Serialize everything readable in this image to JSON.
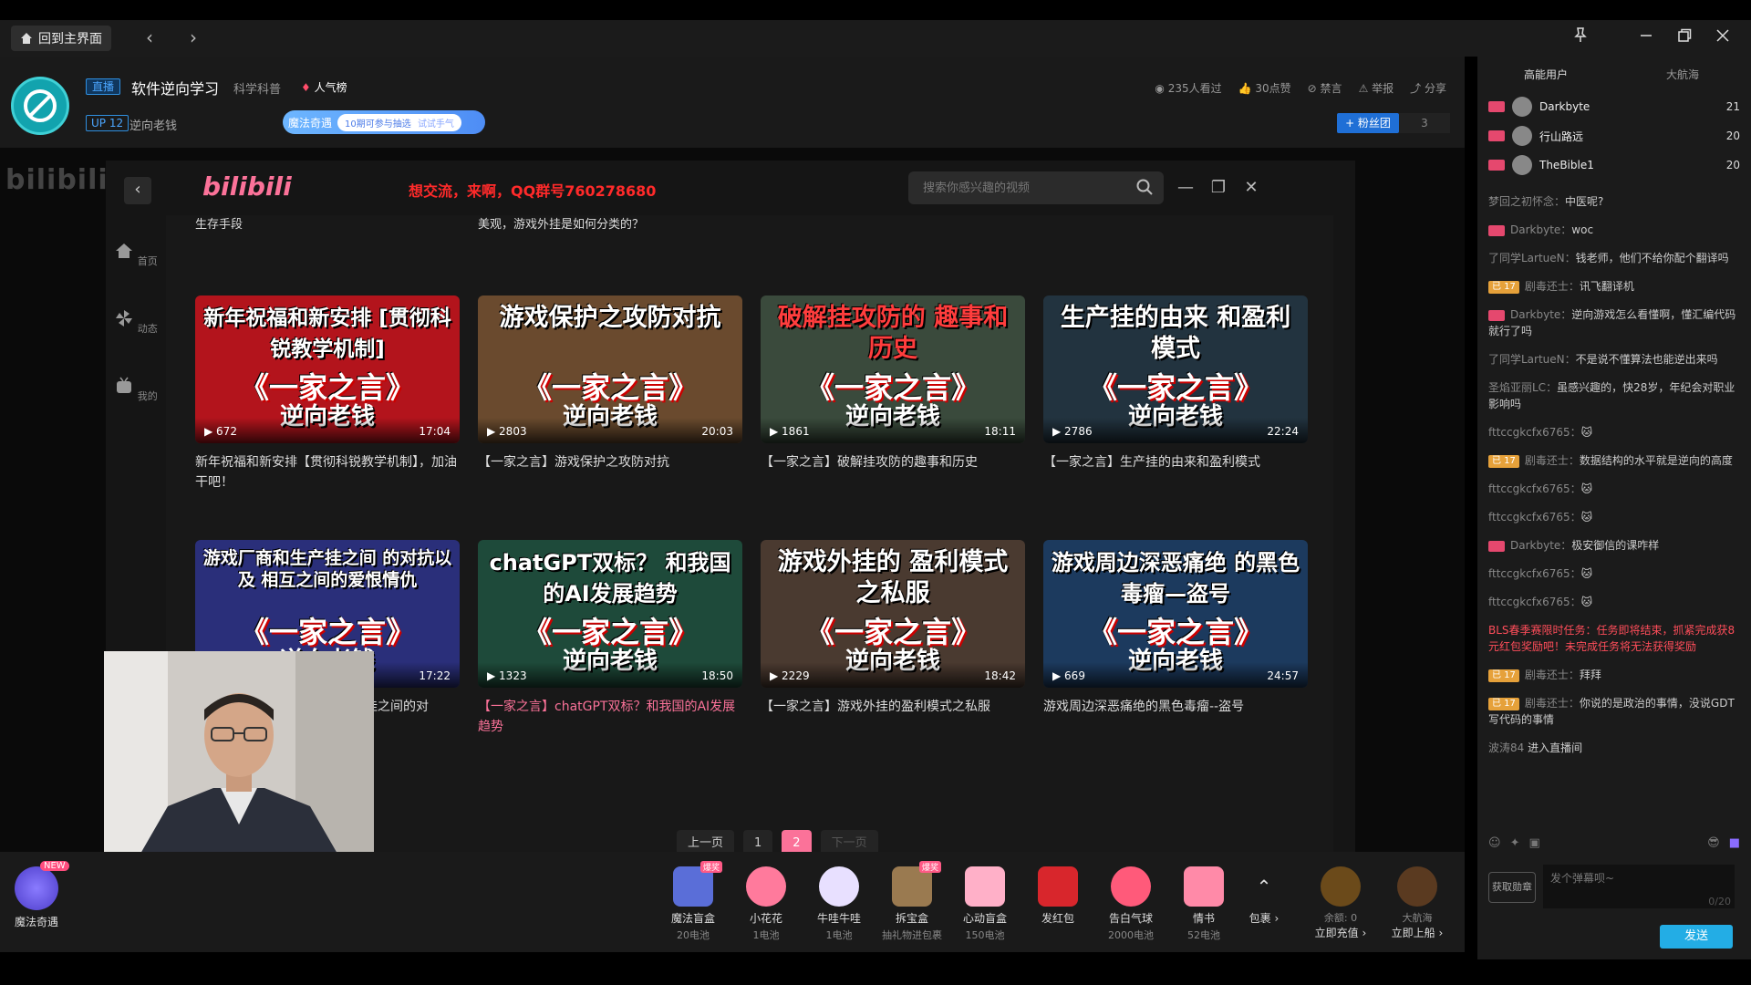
{
  "topbar": {
    "home_label": "回到主界面",
    "back": "‹",
    "forward": "›"
  },
  "header": {
    "live_tag": "直播",
    "title": "软件逆向学习",
    "category": "科学科普",
    "hot_rank": "人气榜",
    "up_level": "UP 12",
    "up_name": "逆向老钱",
    "magic_label": "魔法奇遇",
    "magic_promo": "10期可参与抽选",
    "magic_try": "试试手气",
    "stats": [
      "235人看过",
      "30点赞",
      "禁言",
      "举报",
      "分享"
    ],
    "fans_label": "+ 粉丝团",
    "fans_count": "3"
  },
  "browser": {
    "watermark": "bilibili直播",
    "logo": "bilibili",
    "notice": "想交流，来啊，QQ群号760278680",
    "search_placeholder": "搜索你感兴趣的视频",
    "side": [
      {
        "label": "首页"
      },
      {
        "label": "动态"
      },
      {
        "label": "我的"
      }
    ],
    "top_row": [
      "生存手段",
      "美观，游戏外挂是如何分类的？",
      "",
      ""
    ],
    "cards": [
      {
        "t1": "新年祝福和新安排 [贯彻科锐教学机制]",
        "t2": "《一家之言》",
        "t3": "逆向老钱",
        "plays": "672",
        "duration": "17:04",
        "title": "新年祝福和新安排【贯彻科锐教学机制】，加油干吧！",
        "bg": "#b3141c"
      },
      {
        "t1": "游戏保护之攻防对抗",
        "t2": "《一家之言》",
        "t3": "逆向老钱",
        "plays": "2803",
        "duration": "20:03",
        "title": "【一家之言】游戏保护之攻防对抗",
        "bg": "#6a4a2e"
      },
      {
        "t1": "破解挂攻防的 趣事和历史",
        "t2": "《一家之言》",
        "t3": "逆向老钱",
        "plays": "1861",
        "duration": "18:11",
        "title": "【一家之言】破解挂攻防的趣事和历史",
        "bg": "#3a4a3c"
      },
      {
        "t1": "生产挂的由来 和盈利模式",
        "t2": "《一家之言》",
        "t3": "逆向老钱",
        "plays": "2786",
        "duration": "22:24",
        "title": "【一家之言】生产挂的由来和盈利模式",
        "bg": "#22333f"
      },
      {
        "t1": "游戏厂商和生产挂之间 的对抗以及 相互之间的爱恨情仇",
        "t2": "《一家之言》",
        "t3": "逆向老钱",
        "plays": "",
        "duration": "17:22",
        "title": "挂之间的对",
        "bg": "#2a2f7a"
      },
      {
        "t1": "chatGPT双标？ 和我国的AI发展趋势",
        "t2": "《一家之言》",
        "t3": "逆向老钱",
        "plays": "1323",
        "duration": "18:50",
        "title": "【一家之言】chatGPT双标？和我国的AI发展趋势",
        "bg": "#1e4a3a"
      },
      {
        "t1": "游戏外挂的 盈利模式之私服",
        "t2": "《一家之言》",
        "t3": "逆向老钱",
        "plays": "2229",
        "duration": "18:42",
        "title": "【一家之言】游戏外挂的盈利模式之私服",
        "bg": "#4a3a30"
      },
      {
        "t1": "游戏周边深恶痛绝 的黑色毒瘤—盗号",
        "t2": "《一家之言》",
        "t3": "逆向老钱",
        "plays": "669",
        "duration": "24:57",
        "title": "游戏周边深恶痛绝的黑色毒瘤--盗号",
        "bg": "#1c3a5e"
      }
    ],
    "pager": {
      "prev": "上一页",
      "p1": "1",
      "p2": "2",
      "next": "下一页"
    }
  },
  "gifts": {
    "magic": {
      "label": "魔法奇遇",
      "badge": "NEW"
    },
    "items": [
      {
        "name": "魔法盲盒",
        "price": "20电池",
        "hot": "爆奖",
        "color": "#5a6ed8"
      },
      {
        "name": "小花花",
        "price": "1电池",
        "hot": "",
        "color": "#ff7a9c"
      },
      {
        "name": "牛哇牛哇",
        "price": "1电池",
        "hot": "",
        "color": "#e8e0ff"
      },
      {
        "name": "拆宝盒",
        "price": "抽礼物进包裹",
        "hot": "爆奖",
        "color": "#9a7a50"
      },
      {
        "name": "心动盲盒",
        "price": "150电池",
        "hot": "",
        "color": "#ffb0c8"
      },
      {
        "name": "发红包",
        "price": "",
        "hot": "",
        "color": "#d8262c"
      },
      {
        "name": "告白气球",
        "price": "2000电池",
        "hot": "",
        "color": "#ff5a7a"
      },
      {
        "name": "情书",
        "price": "52电池",
        "hot": "",
        "color": "#ff8aa8"
      }
    ],
    "pack_label": "包裹",
    "balance": "余额: 0",
    "recharge": "立即充值",
    "captain": "大航海",
    "captain_sub": "立即上船"
  },
  "chat": {
    "tabs": [
      "高能用户",
      "大航海"
    ],
    "rank": [
      {
        "name": "Darkbyte",
        "num": "21"
      },
      {
        "name": "行山路远",
        "num": "20"
      },
      {
        "name": "TheBible1",
        "num": "20"
      }
    ],
    "messages": [
      {
        "badge": "",
        "user": "梦回之初怀念：",
        "text": "中医呢?"
      },
      {
        "badge": "red",
        "user": "Darkbyte：",
        "text": "woc"
      },
      {
        "badge": "",
        "user": "了同学LartueN：",
        "text": "钱老师，他们不给你配个翻译吗"
      },
      {
        "badge": "gold",
        "badge_text": "已 17",
        "user": "剧毒还士：",
        "text": "讯飞翻译机"
      },
      {
        "badge": "red",
        "user": "Darkbyte：",
        "text": "逆向游戏怎么看懂啊，懂汇编代码就行了吗"
      },
      {
        "badge": "",
        "user": "了同学LartueN：",
        "text": "不是说不懂算法也能逆出来吗"
      },
      {
        "badge": "",
        "user": "圣焰亚丽LC：",
        "text": "虽感兴趣的，快28岁，年纪会对职业影响吗"
      },
      {
        "badge": "",
        "user": "fttccgkcfx6765：",
        "text": "🐱"
      },
      {
        "badge": "gold",
        "badge_text": "已 17",
        "user": "剧毒还士：",
        "text": "数据结构的水平就是逆向的高度"
      },
      {
        "badge": "",
        "user": "fttccgkcfx6765：",
        "text": "🐱"
      },
      {
        "badge": "",
        "user": "fttccgkcfx6765：",
        "text": "🐱"
      },
      {
        "badge": "red",
        "user": "Darkbyte：",
        "text": "极安御信的课咋样"
      },
      {
        "badge": "",
        "user": "fttccgkcfx6765：",
        "text": "🐱"
      },
      {
        "badge": "",
        "user": "fttccgkcfx6765：",
        "text": "🐱"
      },
      {
        "notice": true,
        "text": "BLS春季赛限时任务：任务即将结束，抓紧完成获8元红包奖励吧！未完成任务将无法获得奖励"
      },
      {
        "badge": "gold",
        "badge_text": "已 17",
        "user": "剧毒还士：",
        "text": "拜拜"
      },
      {
        "badge": "gold",
        "badge_text": "已 17",
        "user": "剧毒还士：",
        "text": "你说的是政治的事情，没说GDT写代码的事情"
      },
      {
        "badge": "",
        "user": "波涛84",
        "text": " 进入直播间"
      }
    ],
    "medal_label": "获取勋章",
    "input_placeholder": "发个弹幕呗~",
    "char_count": "0/20",
    "send_label": "发送"
  },
  "colors": {
    "accent": "#fb7299",
    "blue": "#23ade5",
    "red_notice": "#ff2a2a"
  }
}
